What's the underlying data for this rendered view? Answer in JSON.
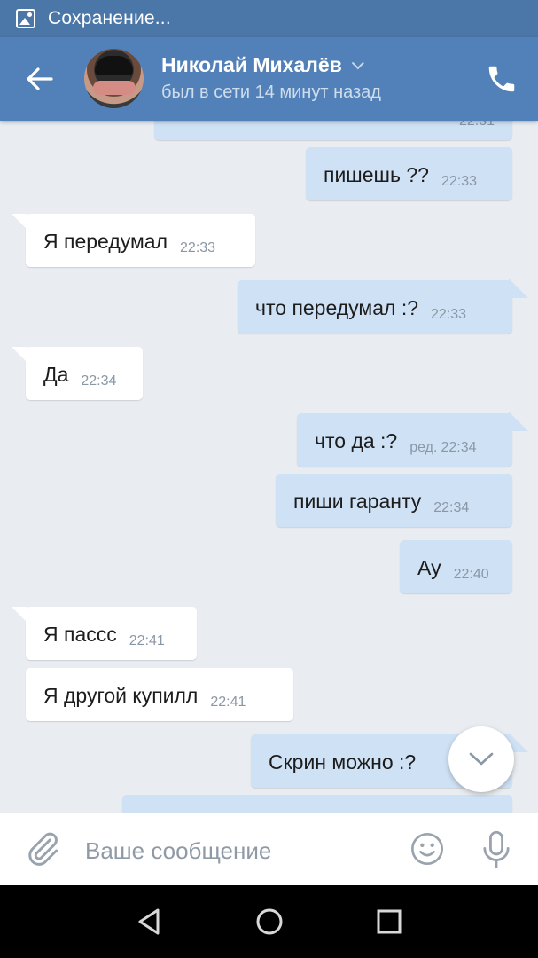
{
  "status_bar": {
    "text": "Сохранение..."
  },
  "header": {
    "contact_name": "Николай Михалёв",
    "last_seen": "был в сети 14 минут назад"
  },
  "messages": [
    {
      "dir": "out",
      "text": "",
      "time": "22:31"
    },
    {
      "dir": "out",
      "text": "пишешь ??",
      "time": "22:33"
    },
    {
      "dir": "in",
      "text": "Я передумал",
      "time": "22:33"
    },
    {
      "dir": "out",
      "text": "что передумал :?",
      "time": "22:33"
    },
    {
      "dir": "in",
      "text": "Да",
      "time": "22:34"
    },
    {
      "dir": "out",
      "text": "что да :?",
      "edited": "ред.",
      "time": "22:34"
    },
    {
      "dir": "out",
      "text": "пиши гаранту",
      "time": "22:34"
    },
    {
      "dir": "out",
      "text": "Ау",
      "time": "22:40"
    },
    {
      "dir": "in",
      "text": "Я пассс",
      "time": "22:41"
    },
    {
      "dir": "in",
      "text": "Я другой купилл",
      "time": "22:41"
    },
    {
      "dir": "out",
      "text": "Скрин можно :?",
      "time": ""
    },
    {
      "dir": "out",
      "text": "",
      "time": ""
    }
  ],
  "composer": {
    "placeholder": "Ваше сообщение"
  },
  "icons": {
    "back": "arrow-left-icon",
    "call": "phone-icon",
    "attach": "paperclip-icon",
    "emoji": "smile-icon",
    "mic": "microphone-icon",
    "scroll": "chevron-down-icon",
    "nav_back": "triangle-back-icon",
    "nav_home": "circle-home-icon",
    "nav_recent": "square-recent-icon"
  },
  "colors": {
    "header": "#5181b8",
    "status_bar": "#4a76a8",
    "chat_bg": "#e9edf1",
    "out_bubble": "#cfe1f4",
    "in_bubble": "#ffffff"
  }
}
